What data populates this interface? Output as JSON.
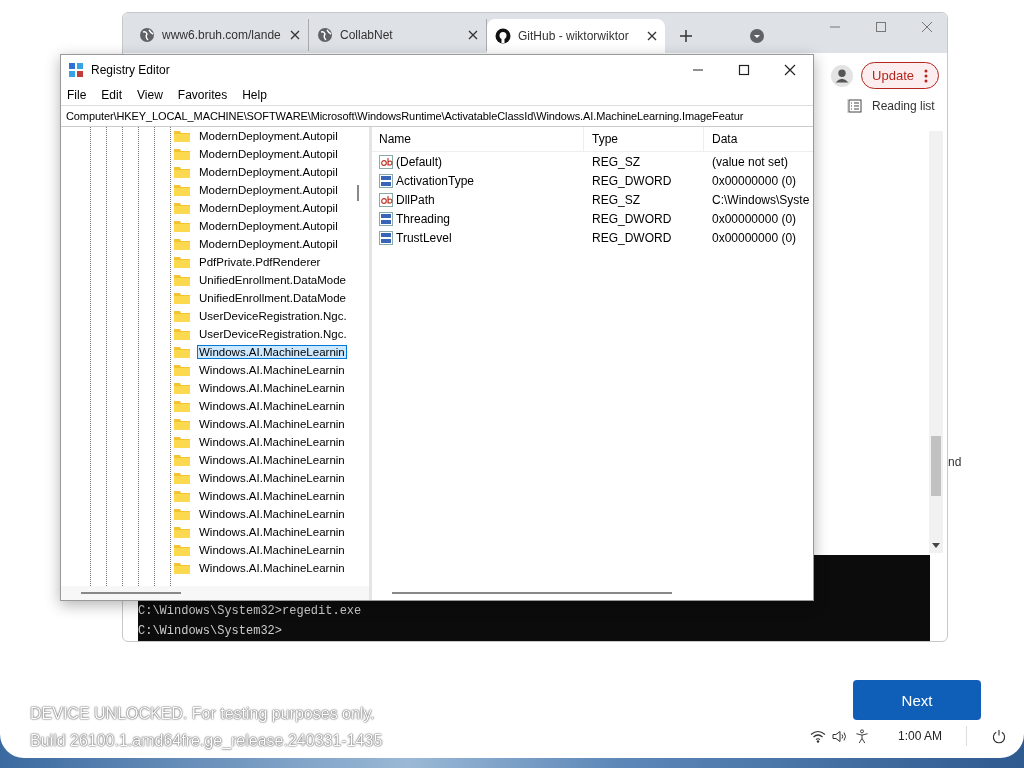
{
  "browser": {
    "tabs": [
      {
        "title": "www6.bruh.com/lande",
        "kind": "globe",
        "selected": false
      },
      {
        "title": "CollabNet",
        "kind": "globe",
        "selected": false
      },
      {
        "title": "GitHub - wiktorwiktor",
        "kind": "logo",
        "selected": true
      }
    ],
    "update_button": "Update",
    "reading_list": "Reading list",
    "partial_text": "nd"
  },
  "console": {
    "lines": [
      "C:\\Windows\\System32>regedit.exe",
      "C:\\Windows\\System32>"
    ]
  },
  "registry": {
    "title": "Registry Editor",
    "menu": [
      "File",
      "Edit",
      "View",
      "Favorites",
      "Help"
    ],
    "address": "Computer\\HKEY_LOCAL_MACHINE\\SOFTWARE\\Microsoft\\WindowsRuntime\\ActivatableClassId\\Windows.AI.MachineLearning.ImageFeatur",
    "tree": [
      {
        "label": "ModernDeployment.Autopil",
        "selected": false
      },
      {
        "label": "ModernDeployment.Autopil",
        "selected": false
      },
      {
        "label": "ModernDeployment.Autopil",
        "selected": false
      },
      {
        "label": "ModernDeployment.Autopil",
        "selected": false
      },
      {
        "label": "ModernDeployment.Autopil",
        "selected": false
      },
      {
        "label": "ModernDeployment.Autopil",
        "selected": false
      },
      {
        "label": "ModernDeployment.Autopil",
        "selected": false
      },
      {
        "label": "PdfPrivate.PdfRenderer",
        "selected": false
      },
      {
        "label": "UnifiedEnrollment.DataMode",
        "selected": false
      },
      {
        "label": "UnifiedEnrollment.DataMode",
        "selected": false
      },
      {
        "label": "UserDeviceRegistration.Ngc.",
        "selected": false
      },
      {
        "label": "UserDeviceRegistration.Ngc.",
        "selected": false
      },
      {
        "label": "Windows.AI.MachineLearnin",
        "selected": true
      },
      {
        "label": "Windows.AI.MachineLearnin",
        "selected": false
      },
      {
        "label": "Windows.AI.MachineLearnin",
        "selected": false
      },
      {
        "label": "Windows.AI.MachineLearnin",
        "selected": false
      },
      {
        "label": "Windows.AI.MachineLearnin",
        "selected": false
      },
      {
        "label": "Windows.AI.MachineLearnin",
        "selected": false
      },
      {
        "label": "Windows.AI.MachineLearnin",
        "selected": false
      },
      {
        "label": "Windows.AI.MachineLearnin",
        "selected": false
      },
      {
        "label": "Windows.AI.MachineLearnin",
        "selected": false
      },
      {
        "label": "Windows.AI.MachineLearnin",
        "selected": false
      },
      {
        "label": "Windows.AI.MachineLearnin",
        "selected": false
      },
      {
        "label": "Windows.AI.MachineLearnin",
        "selected": false
      },
      {
        "label": "Windows.AI.MachineLearnin",
        "selected": false
      }
    ],
    "columns": [
      "Name",
      "Type",
      "Data"
    ],
    "values": [
      {
        "name": "(Default)",
        "kind": "string",
        "type": "REG_SZ",
        "data": "(value not set)"
      },
      {
        "name": "ActivationType",
        "kind": "binary",
        "type": "REG_DWORD",
        "data": "0x00000000 (0)"
      },
      {
        "name": "DllPath",
        "kind": "string",
        "type": "REG_SZ",
        "data": "C:\\Windows\\Syste"
      },
      {
        "name": "Threading",
        "kind": "binary",
        "type": "REG_DWORD",
        "data": "0x00000000 (0)"
      },
      {
        "name": "TrustLevel",
        "kind": "binary",
        "type": "REG_DWORD",
        "data": "0x00000000 (0)"
      }
    ]
  },
  "footer": {
    "notice": [
      "DEVICE UNLOCKED. For testing purposes only.",
      "Build 26100.1.amd64fre.ge_release.240331-1435"
    ],
    "next_button": "Next",
    "time": "1:00 AM"
  }
}
